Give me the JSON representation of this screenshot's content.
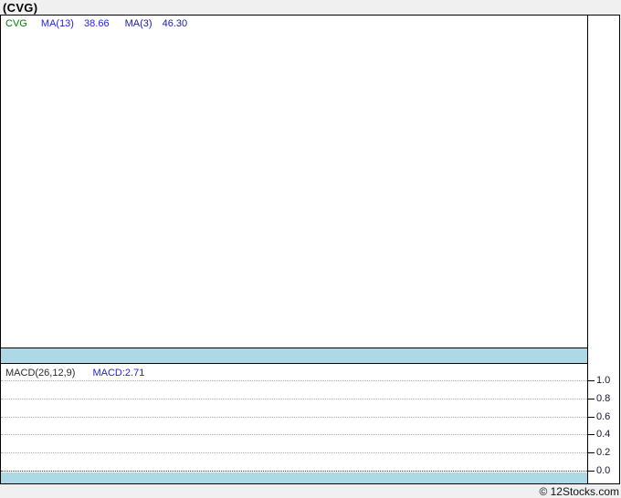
{
  "page": {
    "title": "(CVG)",
    "credit": "© 12Stocks.com"
  },
  "price_panel": {
    "legend": {
      "symbol": "CVG",
      "ma13_label": "MA(13)",
      "ma13_value": "38.66",
      "ma3_label": "MA(3)",
      "ma3_value": "46.30"
    }
  },
  "macd_panel": {
    "legend": {
      "name": "MACD(26,12,9)",
      "value_label": "MACD:2.71"
    },
    "yticks": [
      "1.0",
      "0.8",
      "0.6",
      "0.4",
      "0.2",
      "0.0"
    ]
  },
  "colors": {
    "highlight_band": "#ADD8E6",
    "symbol_green": "#008000",
    "ma_blue": "#2424d6",
    "ma3_blue": "#1b1b9e",
    "grid_dotted_gray": "#a8a8a8",
    "zero_line_dark": "#3a3a3a",
    "frame_border": "#000000",
    "page_background": "#f0f0f0"
  },
  "chart_data": [
    {
      "type": "line",
      "title": "(CVG) price panel with moving averages",
      "series": [
        {
          "name": "CVG",
          "color": "#008000",
          "values": []
        },
        {
          "name": "MA(13)",
          "color": "#2424d6",
          "last_value": 38.66,
          "values": []
        },
        {
          "name": "MA(3)",
          "color": "#1b1b9e",
          "last_value": 46.3,
          "values": []
        }
      ],
      "legend_position": "top-left",
      "grid": false,
      "note": "plot area renders blank in the screenshot; a light-blue highlight band spans the bottom of the panel"
    },
    {
      "type": "line",
      "title": "MACD(26,12,9)",
      "series": [
        {
          "name": "MACD",
          "last_value": 2.71,
          "values": []
        }
      ],
      "yticks": [
        1.0,
        0.8,
        0.6,
        0.4,
        0.2,
        0.0
      ],
      "ylim": [
        -0.15,
        1.15
      ],
      "grid": "horizontal dotted, zero line emphasized",
      "legend_position": "top-left",
      "note": "no MACD curve visible; a light-blue highlight band spans the bottom of the panel"
    }
  ]
}
